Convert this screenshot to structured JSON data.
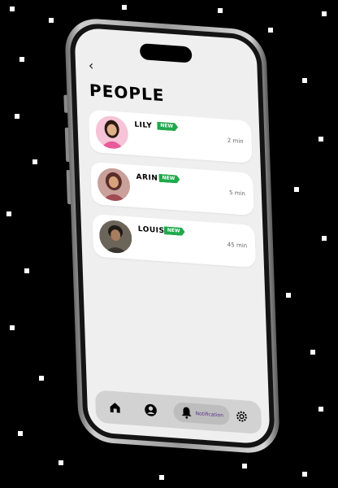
{
  "screen": {
    "title": "PEOPLE",
    "back_icon": "chevron-left-icon"
  },
  "people": [
    {
      "name": "LILY",
      "badge": "NEW",
      "time": "2 min"
    },
    {
      "name": "ARIN",
      "badge": "NEW",
      "time": "5 min"
    },
    {
      "name": "LOUIS",
      "badge": "NEW",
      "time": "45 min"
    }
  ],
  "nav": {
    "items": [
      {
        "icon": "home-icon"
      },
      {
        "icon": "profile-icon"
      },
      {
        "icon": "bell-icon",
        "label": "Notification",
        "active": true
      },
      {
        "icon": "gear-icon"
      }
    ]
  },
  "colors": {
    "badge": "#1fa94a",
    "background": "#000000",
    "screen": "#efefef",
    "notification_label": "#5b2d8c"
  }
}
